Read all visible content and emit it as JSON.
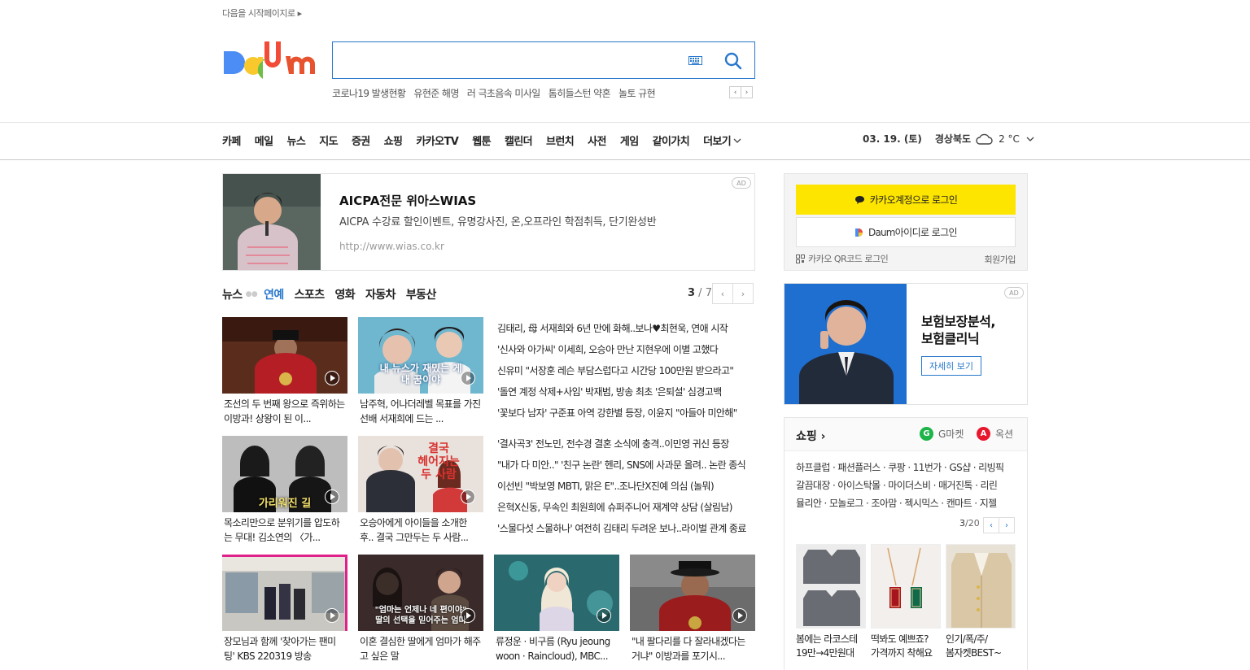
{
  "top": {
    "set_start": "다음을 시작페이지로 ▸"
  },
  "search": {
    "value": "",
    "hot_keywords": [
      "코로나19 발생현황",
      "유현준 해명",
      "러 극초음속 미사일",
      "톰히들스턴 약혼",
      "놀토 규현"
    ],
    "prev": "‹",
    "next": "›"
  },
  "nav": {
    "items": [
      "카페",
      "메일",
      "뉴스",
      "지도",
      "증권",
      "쇼핑",
      "카카오TV",
      "웹툰",
      "캘린더",
      "브런치",
      "사전",
      "게임",
      "같이가치"
    ],
    "more": "더보기",
    "date": "03. 19. (토)",
    "region": "경상북도",
    "temp": "2 °C"
  },
  "ad": {
    "title": "AICPA전문 위아스WIAS",
    "desc": "AICPA 수강료 할인이벤트, 유명강사진, 온,오프라인 학점취득, 단기완성반",
    "url": "http://www.wias.co.kr",
    "badge": "AD"
  },
  "news": {
    "tabs": [
      "뉴스",
      "연예",
      "스포츠",
      "영화",
      "자동차",
      "부동산"
    ],
    "page_current": "3",
    "page_total": " / 7",
    "thumbs_row1": [
      "조선의 두 번째 왕으로 즉위하는 이방과! 상왕이 된 이...",
      "남주혁, 어나더레벨 목표를 가진 선배 서재희에 드는 ..."
    ],
    "thumbs_row2": [
      "목소리만으로 분위기를 압도하는 무대! 김소연의 〈가...",
      "오승아에게 아이들을 소개한 후.. 결국 그만두는 두 사람..."
    ],
    "thumbs_row3": [
      "장모님과 함께 '찾아가는 팬미팅' KBS 220319 방송",
      "이혼 결심한 딸에게 엄마가 해주고 싶은 말",
      "류정운 · 비구름 (Ryu jeoung woon · Raincloud), MBC...",
      "\"내 팔다리를 다 잘라내겠다는 거냐\" 이방과를 포기시..."
    ],
    "list1": [
      "김태리, 母 서재희와 6년 만에 화해..보나♥최현욱, 연애 시작",
      "'신사와 아가씨' 이세희, 오승아 만난 지현우에 이별 고했다",
      "신유미 \"서장훈 레슨 부담스럽다고 시간당 100만원 받으라고\"",
      "'돌연 계정 삭제+사임' 박재범, 방송 최초 '은퇴설' 심경고백",
      "'꽃보다 남자' 구준표 아역 강한별 등장, 이윤지 \"아들아 미안해\""
    ],
    "list2": [
      "'결사곡3' 전노민, 전수경 결혼 소식에 충격..이민영 귀신 등장",
      "\"내가 다 미안..\" '친구 논란' 헨리, SNS에 사과문 올려.. 논란 종식",
      "이선빈 \"박보영 MBTI, 맑은 E\"..조나단X진예 의심 (놀뭐)",
      "은혁X신동, 무속인 최원희에 슈퍼주니어 재계약 상담 (살림남)",
      "'스물다섯 스물하나' 여전히 김태리 두려운 보나..라이벌 관계 종료"
    ],
    "thumb_overlay_1": "내 뉴스가 재밌는 게\n내 꿈이야",
    "thumb_overlay_2": "결국\n헤어지는\n두 사람",
    "thumb_overlay_3": "가리워진 길",
    "thumb_overlay_4": "\"엄마는 언제나 네 편이야\"\n딸의 선택을 믿어주는 엄마"
  },
  "login": {
    "kakao": "카카오계정으로 로그인",
    "daum": "아이디로 로그인",
    "daum_brand": "Daum",
    "qr": "카카오 QR코드 로그인",
    "signup": "회원가입"
  },
  "ad2": {
    "title": "보험보장분석,\n보험클리닉",
    "button": "자세히 보기",
    "badge": "AD"
  },
  "shopping": {
    "title": "쇼핑 ›",
    "gmarket": "G마켓",
    "auction": "옥션",
    "links": [
      "하프클럽 · 패션플러스 · 쿠팡 · 11번가 · GS샵 · 리빙픽",
      "갈끔대장 · 아이스탁몰 · 마이더스비 · 매거진톡 · 리린",
      "뮬리안 · 모놀로그 · 조아맘 · 젝시믹스 · 캔마트 · 지젤"
    ],
    "page_current": "3",
    "page_total": "/20",
    "products": [
      {
        "line1": "봄에는 라코스테",
        "line2": "19만→4만원대"
      },
      {
        "line1": "떡봐도 예쁘죠?",
        "line2": "가격까지 착해요"
      },
      {
        "line1": "인기/폭/주/",
        "line2": "봄자켓BEST~"
      }
    ]
  },
  "colors": {
    "accent": "#2878cc",
    "kakao": "#fee500",
    "gmarket": "#1db44a",
    "auction": "#e8172d"
  }
}
